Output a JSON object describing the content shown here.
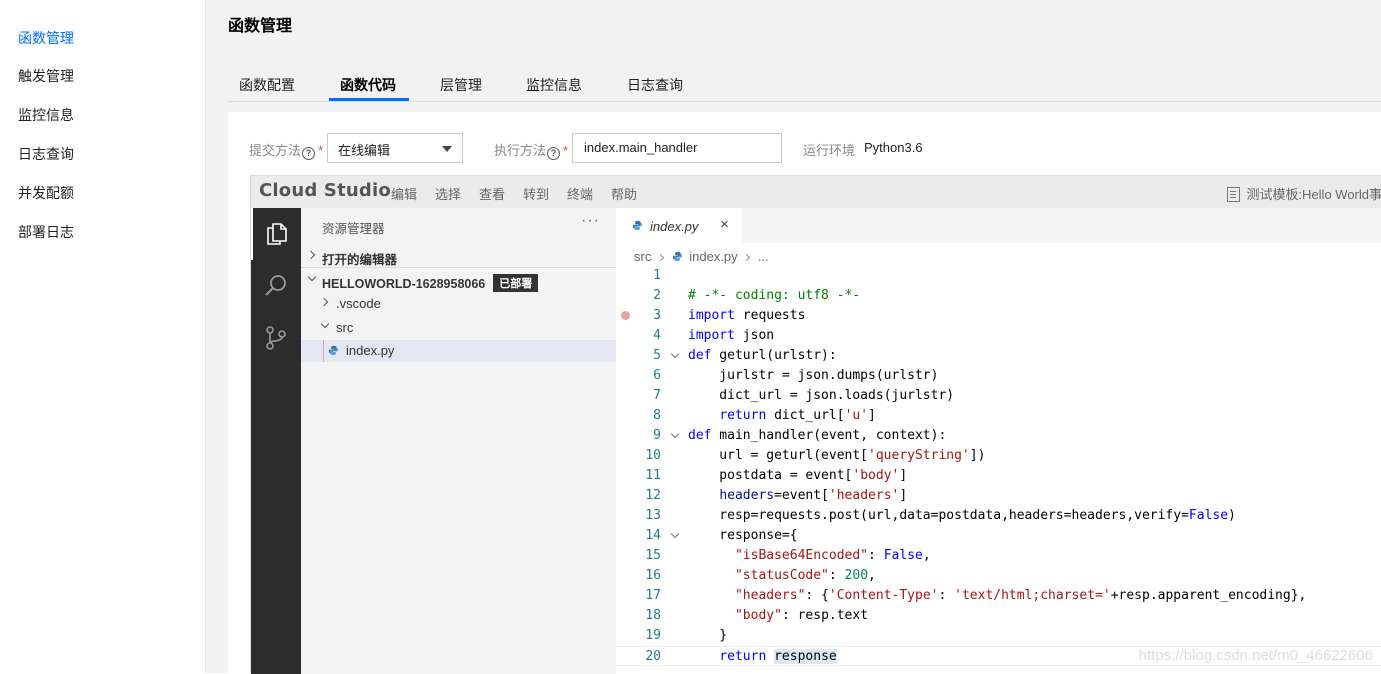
{
  "sidebar": {
    "items": [
      {
        "label": "函数管理",
        "active": true
      },
      {
        "label": "触发管理",
        "active": false
      },
      {
        "label": "监控信息",
        "active": false
      },
      {
        "label": "日志查询",
        "active": false
      },
      {
        "label": "并发配额",
        "active": false
      },
      {
        "label": "部署日志",
        "active": false
      }
    ]
  },
  "header": {
    "title": "函数管理"
  },
  "tabs": [
    {
      "label": "函数配置",
      "active": false
    },
    {
      "label": "函数代码",
      "active": true
    },
    {
      "label": "层管理",
      "active": false
    },
    {
      "label": "监控信息",
      "active": false
    },
    {
      "label": "日志查询",
      "active": false
    }
  ],
  "form": {
    "submit_method_label": "提交方法",
    "submit_method_value": "在线编辑",
    "exec_method_label": "执行方法",
    "exec_method_value": "index.main_handler",
    "runtime_label": "运行环境",
    "runtime_value": "Python3.6",
    "required_mark": "*",
    "help_glyph": "?"
  },
  "ide": {
    "logo": "Cloud Studio",
    "menu": [
      "编辑",
      "选择",
      "查看",
      "转到",
      "终端",
      "帮助"
    ],
    "template_label": "测试模板:Hello World事",
    "explorer": {
      "title": "资源管理器",
      "more": "···",
      "open_editors": "打开的编辑器",
      "project": "HELLOWORLD-1628958066",
      "project_badge": "已部署",
      "folders": [
        ".vscode",
        "src"
      ],
      "file": "index.py"
    },
    "editor_tab": "index.py",
    "close_glyph": "×",
    "breadcrumb": [
      "src",
      "index.py",
      "..."
    ],
    "current_line": 20,
    "breakpoint_line": 3,
    "code_lines": [
      "",
      "# -*- coding: utf8 -*-",
      "import requests",
      "import json",
      "def geturl(urlstr):",
      "    jurlstr = json.dumps(urlstr)",
      "    dict_url = json.loads(jurlstr)",
      "    return dict_url['u']",
      "def main_handler(event, context):",
      "    url = geturl(event['queryString'])",
      "    postdata = event['body']",
      "    headers=event['headers']",
      "    resp=requests.post(url,data=postdata,headers=headers,verify=False)",
      "    response={",
      "      \"isBase64Encoded\": False,",
      "      \"statusCode\": 200,",
      "      \"headers\": {'Content-Type': 'text/html;charset='+resp.apparent_encoding},",
      "      \"body\": resp.text",
      "    }",
      "    return response"
    ],
    "fold_lines": [
      5,
      9,
      14
    ]
  },
  "watermark": "https://blog.csdn.net/m0_46622606",
  "colors": {
    "accent": "#006eff",
    "activity_bar": "#2c2c2c",
    "badge": "#333333"
  }
}
